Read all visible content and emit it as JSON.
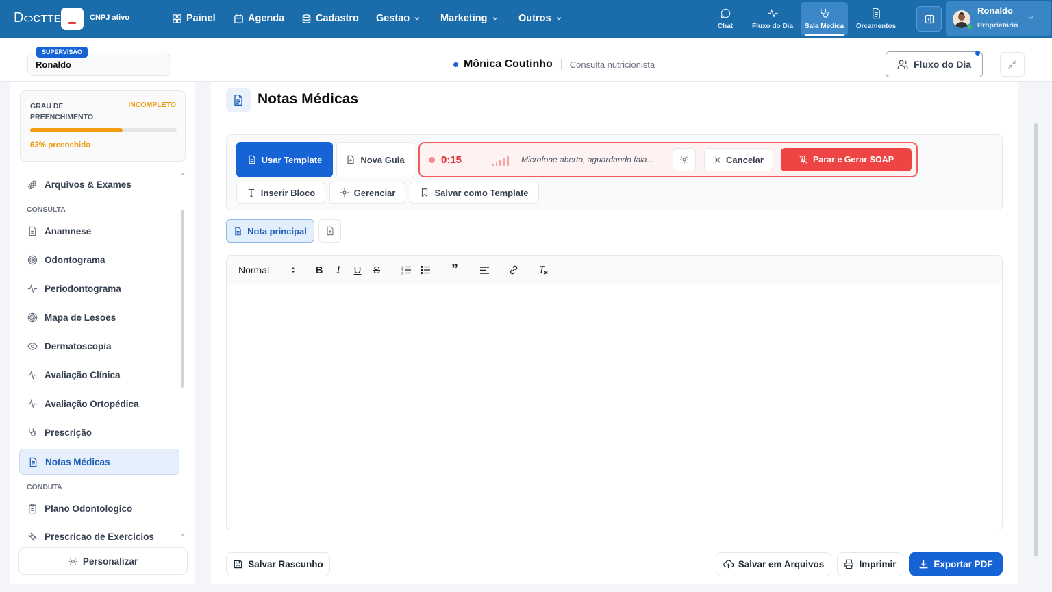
{
  "brand": {
    "logo": "DOCTTE",
    "cnpj_status": "CNPJ ativo"
  },
  "nav": [
    {
      "label": "Painel",
      "icon": "grid-icon"
    },
    {
      "label": "Agenda",
      "icon": "calendar-icon"
    },
    {
      "label": "Cadastro",
      "icon": "database-icon"
    },
    {
      "label": "Gestao",
      "icon": "chevron-down-icon"
    },
    {
      "label": "Marketing",
      "icon": "chevron-down-icon"
    },
    {
      "label": "Outros",
      "icon": "chevron-down-icon"
    }
  ],
  "quick_nav": [
    {
      "label": "Chat",
      "icon": "chat-icon"
    },
    {
      "label": "Fluxo do Dia",
      "icon": "activity-icon"
    },
    {
      "label": "Sala Medica",
      "icon": "stethoscope-icon",
      "active": true
    },
    {
      "label": "Orcamentos",
      "icon": "document-icon"
    }
  ],
  "user": {
    "name": "Ronaldo",
    "role": "Proprietário"
  },
  "supervision": {
    "badge": "SUPERVISÃO",
    "name": "Ronaldo"
  },
  "patient": {
    "name": "Mônica Coutinho",
    "type": "Consulta nutricionista"
  },
  "fluxo_button": "Fluxo do Dia",
  "progress": {
    "label": "GRAU DE PREENCHIMENTO",
    "status": "INCOMPLETO",
    "percent": 63,
    "text": "63% preenchido"
  },
  "sidebar": {
    "items": [
      {
        "label": "Arquivos & Exames",
        "icon": "paperclip-icon"
      },
      {
        "label": "Anamnese",
        "icon": "file-icon"
      },
      {
        "label": "Odontograma",
        "icon": "target-icon"
      },
      {
        "label": "Periodontograma",
        "icon": "activity-icon"
      },
      {
        "label": "Mapa de Lesoes",
        "icon": "target-icon"
      },
      {
        "label": "Dermatoscopia",
        "icon": "eye-icon"
      },
      {
        "label": "Avaliação Clínica",
        "icon": "activity-icon"
      },
      {
        "label": "Avaliação Ortopédica",
        "icon": "activity-icon"
      },
      {
        "label": "Prescrição",
        "icon": "stethoscope-icon"
      },
      {
        "label": "Notas Médicas",
        "icon": "file-text-icon",
        "active": true
      },
      {
        "label": "Plano Odontologico",
        "icon": "clipboard-icon"
      },
      {
        "label": "Prescricao de Exercicios",
        "icon": "dumbbell-icon"
      }
    ],
    "sections": {
      "consulta": "CONSULTA",
      "conduta": "CONDUTA"
    },
    "personalize": "Personalizar"
  },
  "page": {
    "title": "Notas Médicas"
  },
  "toolbar": {
    "use_template": "Usar Template",
    "new_guide": "Nova Guia",
    "insert_block": "Inserir Bloco",
    "manage": "Gerenciar",
    "save_template": "Salvar como Template"
  },
  "recording": {
    "time": "0:15",
    "message": "Microfone aberto, aguardando fala...",
    "cancel": "Cancelar",
    "stop": "Parar e Gerar SOAP"
  },
  "tabs": {
    "main": "Nota principal"
  },
  "editor": {
    "format": "Normal",
    "tools": [
      "B",
      "I",
      "U",
      "S",
      "ordered-list",
      "bullet-list",
      "quote",
      "align",
      "link",
      "clear-format"
    ]
  },
  "footer": {
    "save_draft": "Salvar Rascunho",
    "save_files": "Salvar em Arquivos",
    "print": "Imprimir",
    "export": "Exportar PDF"
  },
  "colors": {
    "topbar": "#1b6cab",
    "primary": "#1663d6",
    "danger": "#ef4444",
    "warning": "#f39c12"
  }
}
